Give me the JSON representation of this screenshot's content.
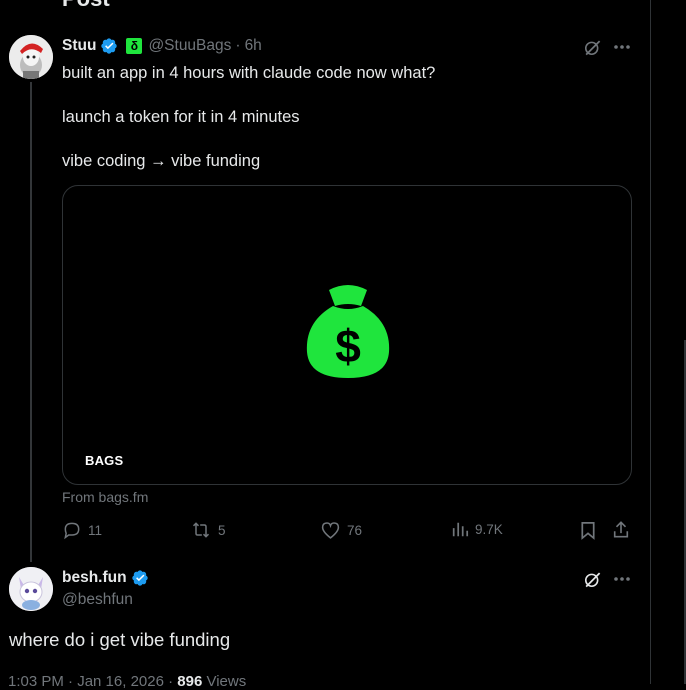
{
  "top_cut_text": "Post",
  "tweet1": {
    "author_name": "Stuu",
    "handle": "@StuuBags",
    "separator": "·",
    "time": "6h",
    "badge_glyph": "δ",
    "lines": [
      "built an app in 4 hours with claude code now what?",
      "launch a token for it in 4 minutes",
      "vibe coding → vibe funding"
    ],
    "card": {
      "label": "BAGS",
      "source": "From bags.fm",
      "accent": "#1fe53d"
    },
    "stats": {
      "replies": "11",
      "reposts": "5",
      "likes": "76",
      "views": "9.7K"
    }
  },
  "tweet2": {
    "author_name": "besh.fun",
    "handle": "@beshfun",
    "body": "where do i get vibe funding",
    "time": "1:03 PM · Jan 16, 2026 ·",
    "views_count": "896",
    "views_label": "Views"
  },
  "colors": {
    "verified": "#1d9bf0",
    "muted": "#71767b",
    "text": "#e7e9ea"
  }
}
